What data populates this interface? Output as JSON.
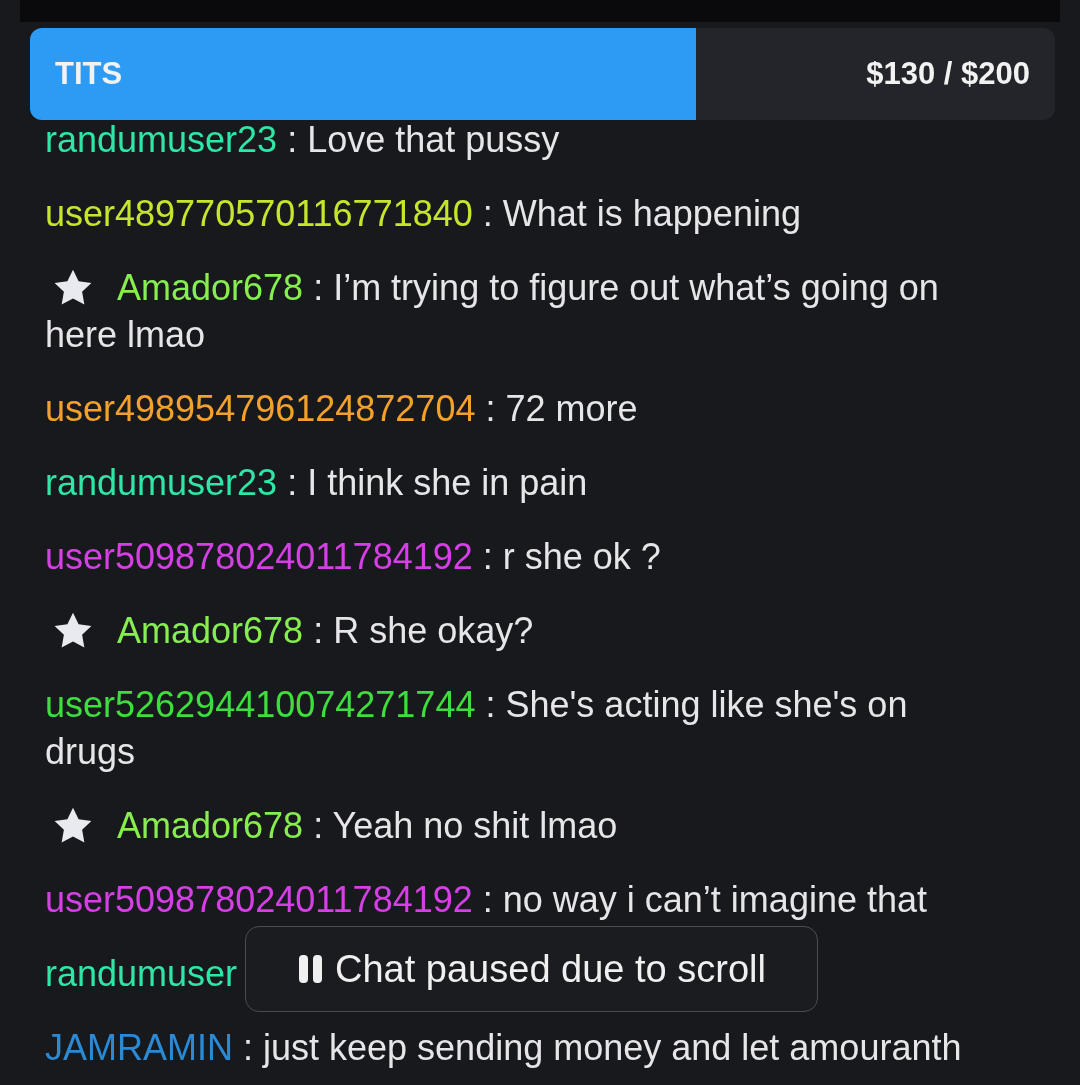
{
  "goal": {
    "label": "TITS",
    "amount": "$130 / $200",
    "level": 0.65
  },
  "messages": [
    {
      "user": "randumuser23",
      "color": "#2ee6a6",
      "star": false,
      "text": ": Love that pussy"
    },
    {
      "user": "user489770570116771840",
      "color": "#c6e62c",
      "star": false,
      "text": ": What is happening"
    },
    {
      "user": "Amador678",
      "color": "#86ee4e",
      "star": true,
      "text": ": I’m trying to figure out what’s going on here lmao"
    },
    {
      "user": "user498954796124872704",
      "color": "#f3a12c",
      "star": false,
      "text": ": 72 more"
    },
    {
      "user": "randumuser23",
      "color": "#2ee6a6",
      "star": false,
      "text": ": I think she in pain"
    },
    {
      "user": "user509878024011784192",
      "color": "#d63fe6",
      "star": false,
      "text": ": r she ok ?"
    },
    {
      "user": "Amador678",
      "color": "#86ee4e",
      "star": true,
      "text": ": R she okay?"
    },
    {
      "user": "user526294410074271744",
      "color": "#3ede3e",
      "star": false,
      "text": ": She's acting like she's on drugs"
    },
    {
      "user": "Amador678",
      "color": "#86ee4e",
      "star": true,
      "text": ": Yeah no shit lmao"
    },
    {
      "user": "user509878024011784192",
      "color": "#d63fe6",
      "star": false,
      "text": ": no way i can’t imagine that"
    },
    {
      "user": "randumuser",
      "color": "#2ee6a6",
      "star": false
    },
    {
      "user": "JAMRAMIN",
      "color": "#2b8ad6",
      "star": false,
      "text": ": just keep sending money and let amouranth"
    }
  ],
  "toast": {
    "text": "Chat paused due to scroll"
  }
}
